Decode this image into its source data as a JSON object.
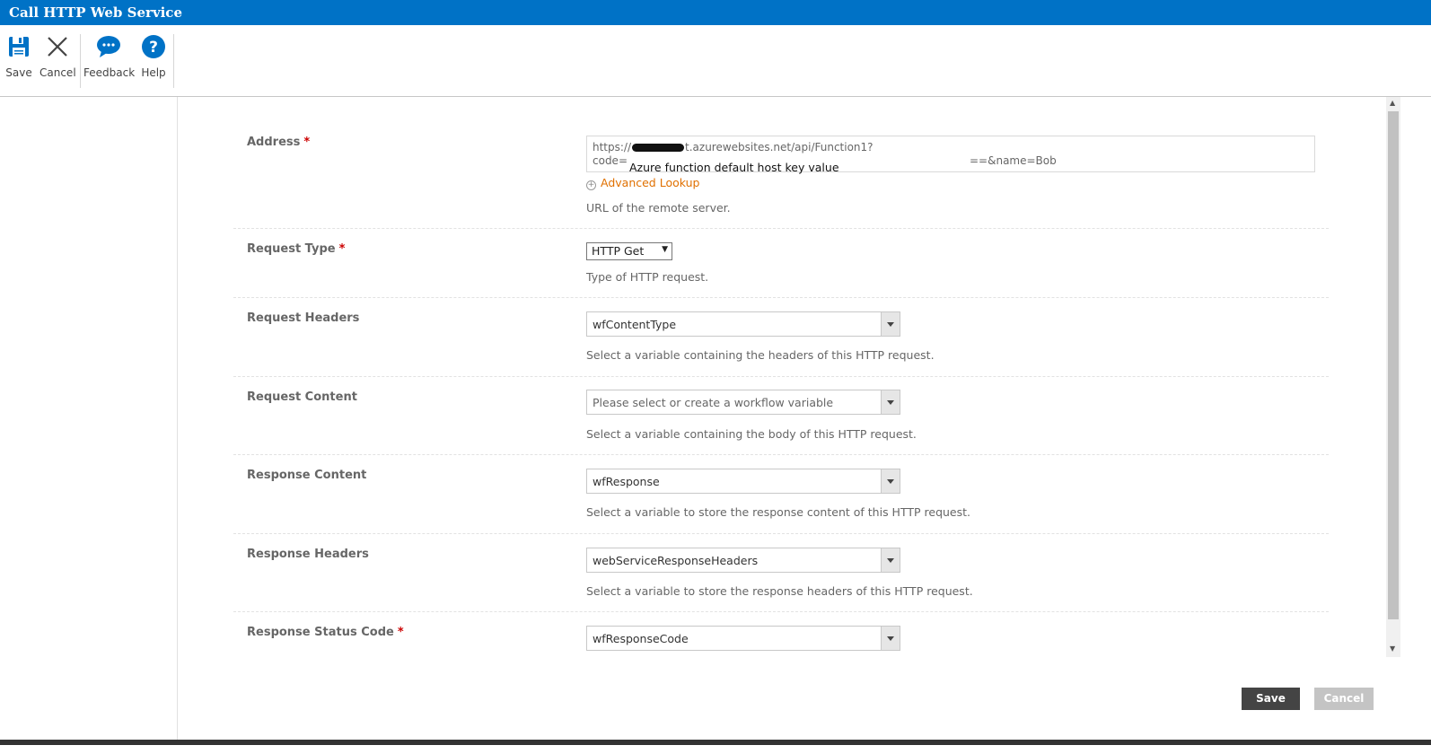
{
  "window": {
    "title": "Call HTTP Web Service"
  },
  "ribbon": {
    "save": {
      "label": "Save",
      "icon": "save-icon"
    },
    "cancel": {
      "label": "Cancel",
      "icon": "close-icon"
    },
    "feedback": {
      "label": "Feedback",
      "icon": "chat-bubble-icon"
    },
    "help": {
      "label": "Help",
      "icon": "question-icon"
    }
  },
  "form": {
    "address": {
      "label": "Address",
      "required_mark": "*",
      "value_line1_prefix": "https://",
      "value_line1_suffix": "t.azurewebsites.net/api/Function1?",
      "value_line2_prefix": "code=",
      "value_line2_suffix": "==&name=Bob",
      "annotation": "Azure function default host key value",
      "lookup_label": "Advanced Lookup",
      "description": "URL of the remote server."
    },
    "request_type": {
      "label": "Request Type",
      "required_mark": "*",
      "value": "HTTP Get",
      "description": "Type of HTTP request."
    },
    "request_headers": {
      "label": "Request Headers",
      "value": "wfContentType",
      "description": "Select a variable containing the headers of this HTTP request."
    },
    "request_content": {
      "label": "Request Content",
      "placeholder": "Please select or create a workflow variable",
      "description": "Select a variable containing the body of this HTTP request."
    },
    "response_content": {
      "label": "Response Content",
      "value": "wfResponse",
      "description": "Select a variable to store the response content of this HTTP request."
    },
    "response_headers": {
      "label": "Response Headers",
      "value": "webServiceResponseHeaders",
      "description": "Select a variable to store the response headers of this HTTP request."
    },
    "response_status_code": {
      "label": "Response Status Code",
      "required_mark": "*",
      "value": "wfResponseCode"
    }
  },
  "footer": {
    "save_label": "Save",
    "cancel_label": "Cancel"
  },
  "colors": {
    "titlebar": "#0072c6",
    "required": "#cc0000",
    "lookup_link": "#e07000",
    "save_button": "#444444",
    "cancel_button": "#c4c4c4"
  }
}
